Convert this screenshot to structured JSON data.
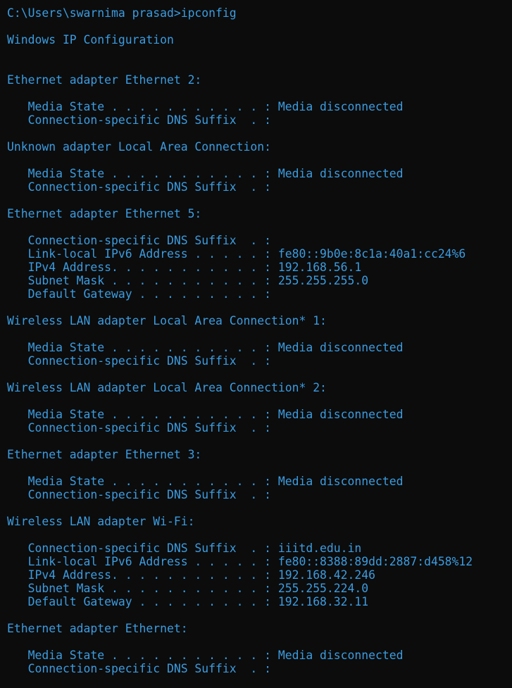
{
  "terminal": {
    "text_color": "#3b9ce0",
    "background_color": "#0c0c0c",
    "lines": [
      "C:\\Users\\swarnima prasad>ipconfig",
      "",
      "Windows IP Configuration",
      "",
      "",
      "Ethernet adapter Ethernet 2:",
      "",
      "   Media State . . . . . . . . . . . : Media disconnected",
      "   Connection-specific DNS Suffix  . :",
      "",
      "Unknown adapter Local Area Connection:",
      "",
      "   Media State . . . . . . . . . . . : Media disconnected",
      "   Connection-specific DNS Suffix  . :",
      "",
      "Ethernet adapter Ethernet 5:",
      "",
      "   Connection-specific DNS Suffix  . :",
      "   Link-local IPv6 Address . . . . . : fe80::9b0e:8c1a:40a1:cc24%6",
      "   IPv4 Address. . . . . . . . . . . : 192.168.56.1",
      "   Subnet Mask . . . . . . . . . . . : 255.255.255.0",
      "   Default Gateway . . . . . . . . . :",
      "",
      "Wireless LAN adapter Local Area Connection* 1:",
      "",
      "   Media State . . . . . . . . . . . : Media disconnected",
      "   Connection-specific DNS Suffix  . :",
      "",
      "Wireless LAN adapter Local Area Connection* 2:",
      "",
      "   Media State . . . . . . . . . . . : Media disconnected",
      "   Connection-specific DNS Suffix  . :",
      "",
      "Ethernet adapter Ethernet 3:",
      "",
      "   Media State . . . . . . . . . . . : Media disconnected",
      "   Connection-specific DNS Suffix  . :",
      "",
      "Wireless LAN adapter Wi-Fi:",
      "",
      "   Connection-specific DNS Suffix  . : iiitd.edu.in",
      "   Link-local IPv6 Address . . . . . : fe80::8388:89dd:2887:d458%12",
      "   IPv4 Address. . . . . . . . . . . : 192.168.42.246",
      "   Subnet Mask . . . . . . . . . . . : 255.255.224.0",
      "   Default Gateway . . . . . . . . . : 192.168.32.11",
      "",
      "Ethernet adapter Ethernet:",
      "",
      "   Media State . . . . . . . . . . . : Media disconnected",
      "   Connection-specific DNS Suffix  . :"
    ]
  }
}
